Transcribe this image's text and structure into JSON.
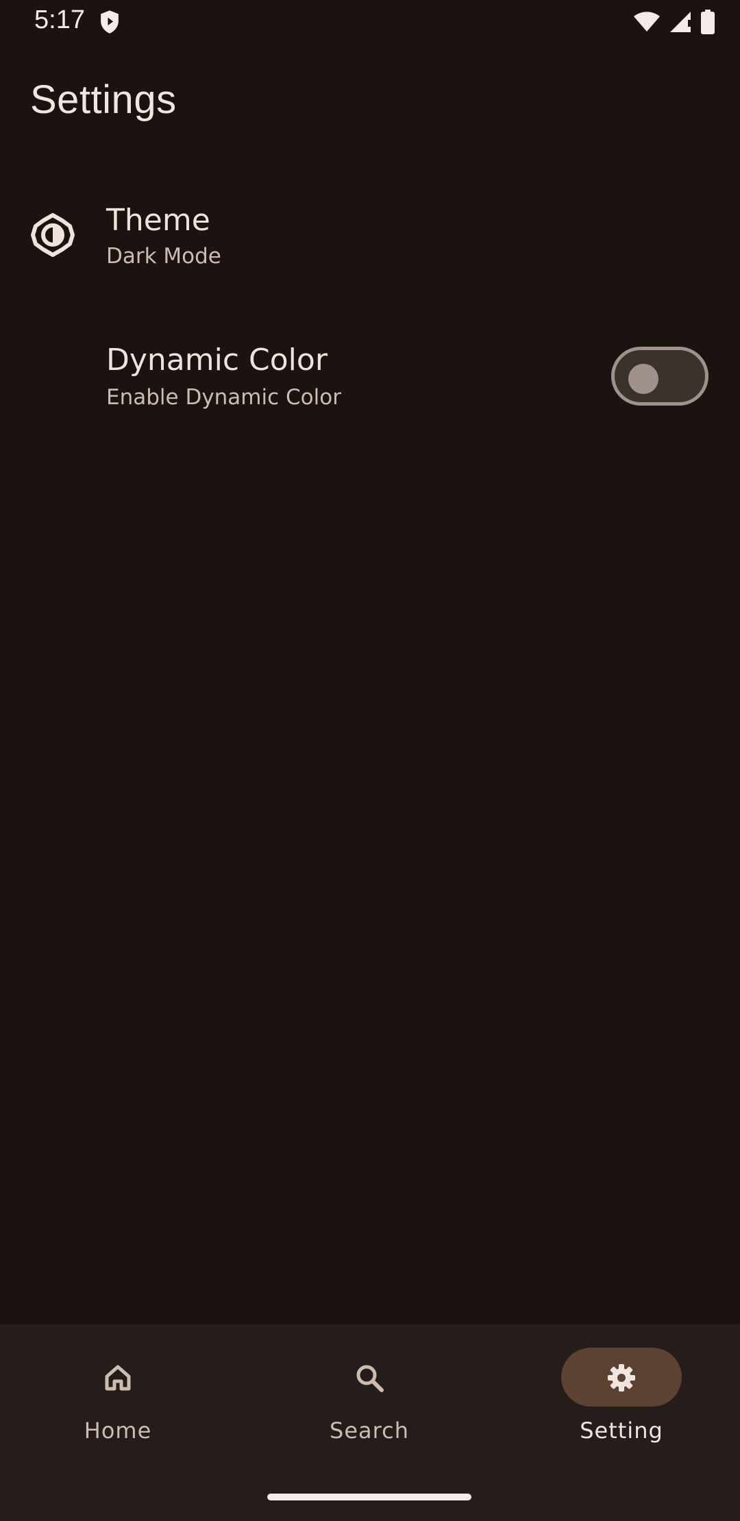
{
  "status_bar": {
    "time": "5:17",
    "icons": [
      "shield-icon",
      "wifi-icon",
      "cell-signal-icon",
      "battery-icon"
    ]
  },
  "page": {
    "title": "Settings"
  },
  "settings": [
    {
      "title": "Theme",
      "subtitle": "Dark Mode",
      "icon": "theme-brightness-icon"
    },
    {
      "title": "Dynamic Color",
      "subtitle": "Enable Dynamic Color",
      "toggle_on": false
    }
  ],
  "bottom_nav": {
    "items": [
      {
        "label": "Home",
        "icon": "home-icon",
        "selected": false
      },
      {
        "label": "Search",
        "icon": "search-icon",
        "selected": false
      },
      {
        "label": "Setting",
        "icon": "gear-icon",
        "selected": true
      }
    ]
  },
  "colors": {
    "background": "#1a1310",
    "nav_background": "#241d19",
    "selected_pill": "#5b4232",
    "text_primary": "#efe3db",
    "text_secondary": "#cdbdb1"
  }
}
